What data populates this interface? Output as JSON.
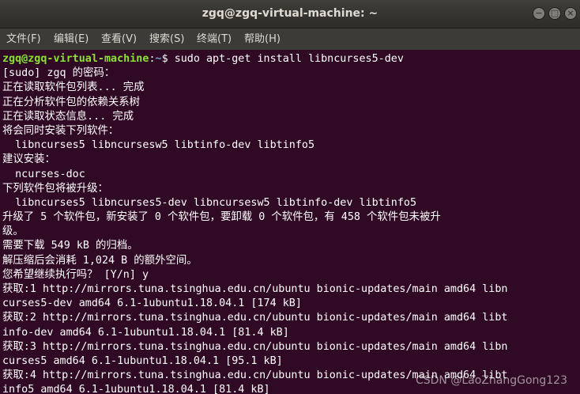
{
  "window": {
    "title": "zgq@zgq-virtual-machine: ~",
    "minimize_glyph": "−",
    "maximize_glyph": "□",
    "close_glyph": "×"
  },
  "menu": [
    "文件(F)",
    "编辑(E)",
    "查看(V)",
    "搜索(S)",
    "终端(T)",
    "帮助(H)"
  ],
  "terminal": {
    "prompt_user_host": "zgq@zgq-virtual-machine",
    "prompt_sep": ":",
    "prompt_path": "~",
    "prompt_symbol": "$ ",
    "command": "sudo apt-get install libncurses5-dev",
    "lines": [
      "[sudo] zgq 的密码：",
      "正在读取软件包列表... 完成",
      "正在分析软件包的依赖关系树",
      "正在读取状态信息... 完成",
      "将会同时安装下列软件：",
      "  libncurses5 libncursesw5 libtinfo-dev libtinfo5",
      "建议安装：",
      "  ncurses-doc",
      "下列软件包将被升级：",
      "  libncurses5 libncurses5-dev libncursesw5 libtinfo-dev libtinfo5",
      "升级了 5 个软件包，新安装了 0 个软件包，要卸载 0 个软件包，有 458 个软件包未被升",
      "级。",
      "需要下载 549 kB 的归档。",
      "解压缩后会消耗 1,024 B 的额外空间。",
      "您希望继续执行吗？ [Y/n] y",
      "获取:1 http://mirrors.tuna.tsinghua.edu.cn/ubuntu bionic-updates/main amd64 libn",
      "curses5-dev amd64 6.1-1ubuntu1.18.04.1 [174 kB]",
      "获取:2 http://mirrors.tuna.tsinghua.edu.cn/ubuntu bionic-updates/main amd64 libt",
      "info-dev amd64 6.1-1ubuntu1.18.04.1 [81.4 kB]",
      "获取:3 http://mirrors.tuna.tsinghua.edu.cn/ubuntu bionic-updates/main amd64 libn",
      "curses5 amd64 6.1-1ubuntu1.18.04.1 [95.1 kB]",
      "获取:4 http://mirrors.tuna.tsinghua.edu.cn/ubuntu bionic-updates/main amd64 libt",
      "info5 amd64 6.1-1ubuntu1.18.04.1 [81.4 kB]"
    ]
  },
  "watermark": "CSDN @LaoZhangGong123"
}
